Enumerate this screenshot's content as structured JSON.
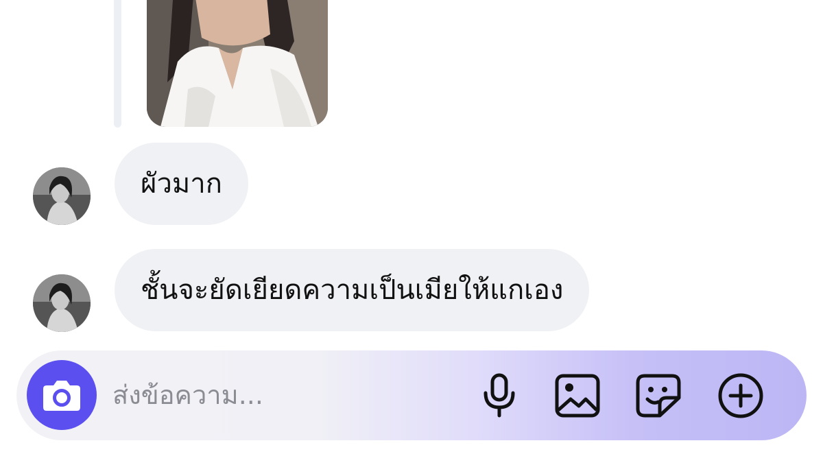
{
  "thread": {
    "messages": [
      {
        "text": "ผัวมาก"
      },
      {
        "text": "ชั้นจะยัดเยียดความเป็นเมียให้แกเอง"
      }
    ]
  },
  "composer": {
    "placeholder": "ส่งข้อความ...",
    "accent_color": "#5b4ff0",
    "icons": [
      "camera-icon",
      "microphone-icon",
      "image-icon",
      "sticker-icon",
      "plus-circle-icon"
    ]
  }
}
